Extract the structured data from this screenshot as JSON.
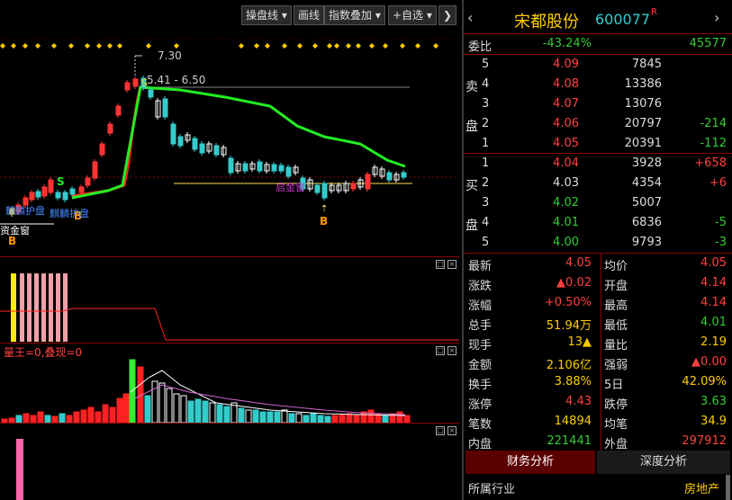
{
  "toolbar": {
    "pan_line": "操盘线",
    "draw": "画线",
    "index_overlay": "指数叠加",
    "add_watch": "+自选"
  },
  "chart": {
    "high_label": "7.30",
    "range_label": "5.41 - 6.50",
    "annot_left1": "麒麟护盘",
    "annot_left2": "麒麟护盘",
    "annot_left3": "资金窗",
    "annot_mid": "启金窗",
    "sub2_label": "量王=0,叠现=0"
  },
  "stock": {
    "name": "宋都股份",
    "code": "600077",
    "badge": "R"
  },
  "commission": {
    "label": "委比",
    "ratio": "-43.24%",
    "diff": "45577"
  },
  "sell_side": {
    "label_chars": [
      "卖",
      "盘"
    ],
    "levels": [
      {
        "idx": "5",
        "price": "4.09",
        "vol": "7845",
        "chg": ""
      },
      {
        "idx": "4",
        "price": "4.08",
        "vol": "13386",
        "chg": ""
      },
      {
        "idx": "3",
        "price": "4.07",
        "vol": "13076",
        "chg": ""
      },
      {
        "idx": "2",
        "price": "4.06",
        "vol": "20797",
        "chg": "-214"
      },
      {
        "idx": "1",
        "price": "4.05",
        "vol": "20391",
        "chg": "-112"
      }
    ]
  },
  "buy_side": {
    "label_chars": [
      "买",
      "盘"
    ],
    "levels": [
      {
        "idx": "1",
        "price": "4.04",
        "vol": "3928",
        "chg": "+658"
      },
      {
        "idx": "2",
        "price": "4.03",
        "vol": "4354",
        "chg": "+6"
      },
      {
        "idx": "3",
        "price": "4.02",
        "vol": "5007",
        "chg": ""
      },
      {
        "idx": "4",
        "price": "4.01",
        "vol": "6836",
        "chg": "-5"
      },
      {
        "idx": "5",
        "price": "4.00",
        "vol": "9793",
        "chg": "-3"
      }
    ]
  },
  "quote": {
    "latest_l": "最新",
    "latest": "4.05",
    "avg_l": "均价",
    "avg": "4.05",
    "change_l": "涨跌",
    "change": "▲0.02",
    "open_l": "开盘",
    "open": "4.14",
    "pct_l": "涨幅",
    "pct": "+0.50%",
    "high_l": "最高",
    "high": "4.14",
    "total_l": "总手",
    "total": "51.94万",
    "low_l": "最低",
    "low": "4.01",
    "cur_l": "现手",
    "cur": "13▲",
    "volratio_l": "量比",
    "volratio": "2.19",
    "amount_l": "金额",
    "amount": "2.106亿",
    "strength_l": "强弱",
    "strength": "▲0.00",
    "turnover_l": "换手",
    "turnover": "3.88%",
    "d5_l": "5日",
    "d5": "42.09%",
    "limitup_l": "涨停",
    "limitup": "4.43",
    "limitdn_l": "跌停",
    "limitdn": "3.63",
    "trades_l": "笔数",
    "trades": "14894",
    "avgtrade_l": "均笔",
    "avgtrade": "34.9",
    "inner_l": "内盘",
    "inner": "221441",
    "outer_l": "外盘",
    "outer": "297912"
  },
  "tabs": {
    "financial": "财务分析",
    "depth": "深度分析"
  },
  "industry": {
    "label": "所属行业",
    "value": "房地产"
  },
  "colors": {
    "up": "#ff4040",
    "down": "#33cc33",
    "cyan": "#33cccc",
    "yellow": "#ffcc00",
    "grid": "#8b0000"
  }
}
